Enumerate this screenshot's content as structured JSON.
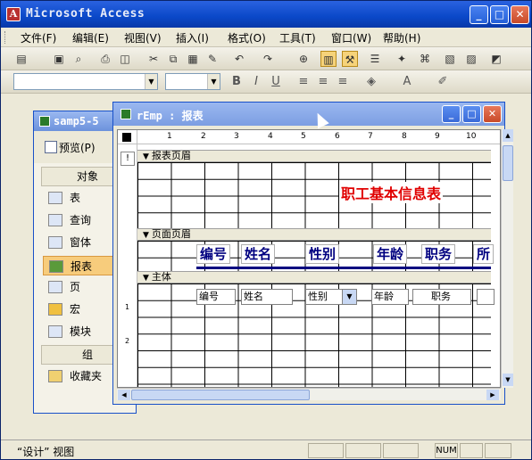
{
  "app": {
    "title": "Microsoft Access",
    "icon": "access-key-icon"
  },
  "menubar": [
    "文件(F)",
    "编辑(E)",
    "视图(V)",
    "插入(I)",
    "格式(O)",
    "工具(T)",
    "窗口(W)",
    "帮助(H)"
  ],
  "status": {
    "text": "“设计” 视图",
    "num": "NUM"
  },
  "db_window": {
    "title": "samp5-5",
    "preview": "预览(P)",
    "objects_header": "对象",
    "objects": [
      "表",
      "查询",
      "窗体",
      "报表",
      "页",
      "宏",
      "模块"
    ],
    "selected_object": "报表",
    "groups_header": "组",
    "favorites": "收藏夹"
  },
  "report_window": {
    "title": "rEmp : 报表",
    "sections": {
      "report_header": "报表页眉",
      "page_header": "页面页眉",
      "detail": "主体"
    },
    "report_title": "职工基本信息表",
    "header_labels": [
      "编号",
      "姓名",
      "性别",
      "年龄",
      "职务",
      "所"
    ],
    "detail_fields": [
      "编号",
      "姓名",
      "性别",
      "年龄",
      "职务"
    ],
    "ruler_numbers": [
      "1",
      "2",
      "3",
      "4",
      "5",
      "6",
      "7",
      "8",
      "9",
      "10"
    ]
  }
}
